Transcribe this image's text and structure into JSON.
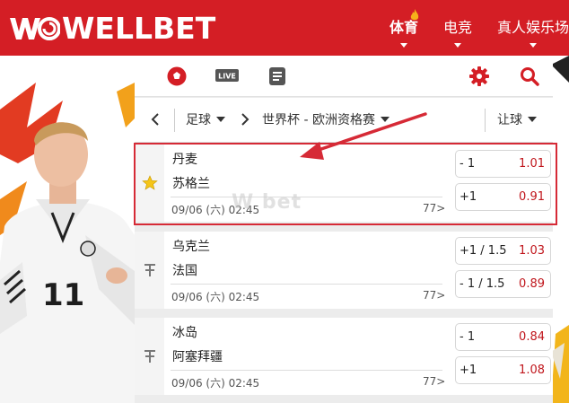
{
  "header": {
    "brand": "WELLBET",
    "nav": [
      {
        "label": "体育",
        "active": true
      },
      {
        "label": "电竞",
        "active": false
      },
      {
        "label": "真人娱乐场",
        "active": false
      }
    ]
  },
  "toolbar": {
    "live_label": "LIVE",
    "icons": [
      "soccer-ball-icon",
      "live-tv-icon",
      "list-icon",
      "settings-gear-icon",
      "search-icon"
    ]
  },
  "filters": {
    "sport": "足球",
    "competition": "世界杯 - 欧洲资格赛",
    "market": "让球"
  },
  "matches": [
    {
      "home": "丹麦",
      "away": "苏格兰",
      "time": "09/06 (六) 02:45",
      "more": "77>",
      "odds": [
        {
          "handicap": "- 1",
          "price": "1.01"
        },
        {
          "handicap": "+1",
          "price": "0.91"
        }
      ],
      "favorite": true
    },
    {
      "home": "乌克兰",
      "away": "法国",
      "time": "09/06 (六) 02:45",
      "more": "77>",
      "odds": [
        {
          "handicap": "+1 / 1.5",
          "price": "1.03"
        },
        {
          "handicap": "- 1 / 1.5",
          "price": "0.89"
        }
      ],
      "favorite": false
    },
    {
      "home": "冰岛",
      "away": "阿塞拜疆",
      "time": "09/06 (六) 02:45",
      "more": "77>",
      "odds": [
        {
          "handicap": "- 1",
          "price": "0.84"
        },
        {
          "handicap": "+1",
          "price": "1.08"
        }
      ],
      "favorite": false
    }
  ],
  "colors": {
    "brand_red": "#d41e25",
    "price_red": "#c0161c",
    "highlight_red": "#d62a36",
    "favorite_star": "#f5c518"
  }
}
